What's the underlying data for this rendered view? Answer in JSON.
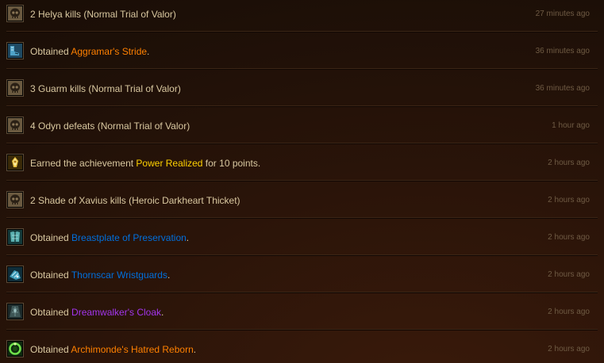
{
  "colors": {
    "legendary": "#ff8000",
    "epic": "#a335ee",
    "rare": "#0070dd",
    "achievement": "#ffd100",
    "text": "#d9c8a0",
    "timestamp": "#6f5b44"
  },
  "feed": [
    {
      "icon": "skull-icon",
      "text": "2 Helya kills (Normal Trial of Valor)",
      "time": "27 minutes ago"
    },
    {
      "icon": "legendary-boots-icon",
      "prefix": "Obtained ",
      "link": "Aggramar's Stride",
      "link_quality": "legendary",
      "suffix": ".",
      "time": "36 minutes ago"
    },
    {
      "icon": "skull-icon",
      "text": "3 Guarm kills (Normal Trial of Valor)",
      "time": "36 minutes ago"
    },
    {
      "icon": "skull-icon",
      "text": "4 Odyn defeats (Normal Trial of Valor)",
      "time": "1 hour ago"
    },
    {
      "icon": "achievement-icon",
      "prefix": "Earned the achievement ",
      "link": "Power Realized",
      "link_quality": "achievement",
      "suffix": " for 10 points.",
      "time": "2 hours ago"
    },
    {
      "icon": "skull-icon",
      "text": "2 Shade of Xavius kills (Heroic Darkheart Thicket)",
      "time": "2 hours ago"
    },
    {
      "icon": "breastplate-icon",
      "prefix": "Obtained ",
      "link": "Breastplate of Preservation",
      "link_quality": "rare",
      "suffix": ".",
      "time": "2 hours ago"
    },
    {
      "icon": "wristguards-icon",
      "prefix": "Obtained ",
      "link": "Thornscar Wristguards",
      "link_quality": "rare",
      "suffix": ".",
      "time": "2 hours ago"
    },
    {
      "icon": "cloak-icon",
      "prefix": "Obtained ",
      "link": "Dreamwalker's Cloak",
      "link_quality": "epic",
      "suffix": ".",
      "time": "2 hours ago"
    },
    {
      "icon": "legendary-ring-icon",
      "prefix": "Obtained ",
      "link": "Archimonde's Hatred Reborn",
      "link_quality": "legendary",
      "suffix": ".",
      "time": "2 hours ago"
    }
  ]
}
